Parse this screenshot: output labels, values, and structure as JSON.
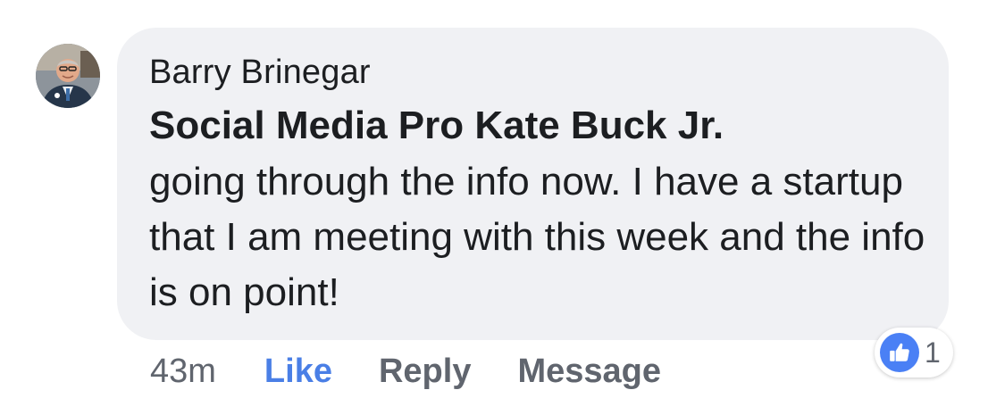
{
  "comment": {
    "author": "Barry Brinegar",
    "mention": "Social Media Pro Kate Buck Jr.",
    "text": "going through the info now. I have a startup that I am meeting with this week and the info is on point!",
    "timestamp": "43m",
    "actions": {
      "like": "Like",
      "reply": "Reply",
      "message": "Message"
    },
    "reaction": {
      "icon": "thumbs-up-icon",
      "count": "1"
    }
  },
  "colors": {
    "bubble": "#f0f1f4",
    "like_link": "#4a7fe6",
    "muted_text": "#60656e",
    "reaction_badge": "#4a80f5"
  }
}
